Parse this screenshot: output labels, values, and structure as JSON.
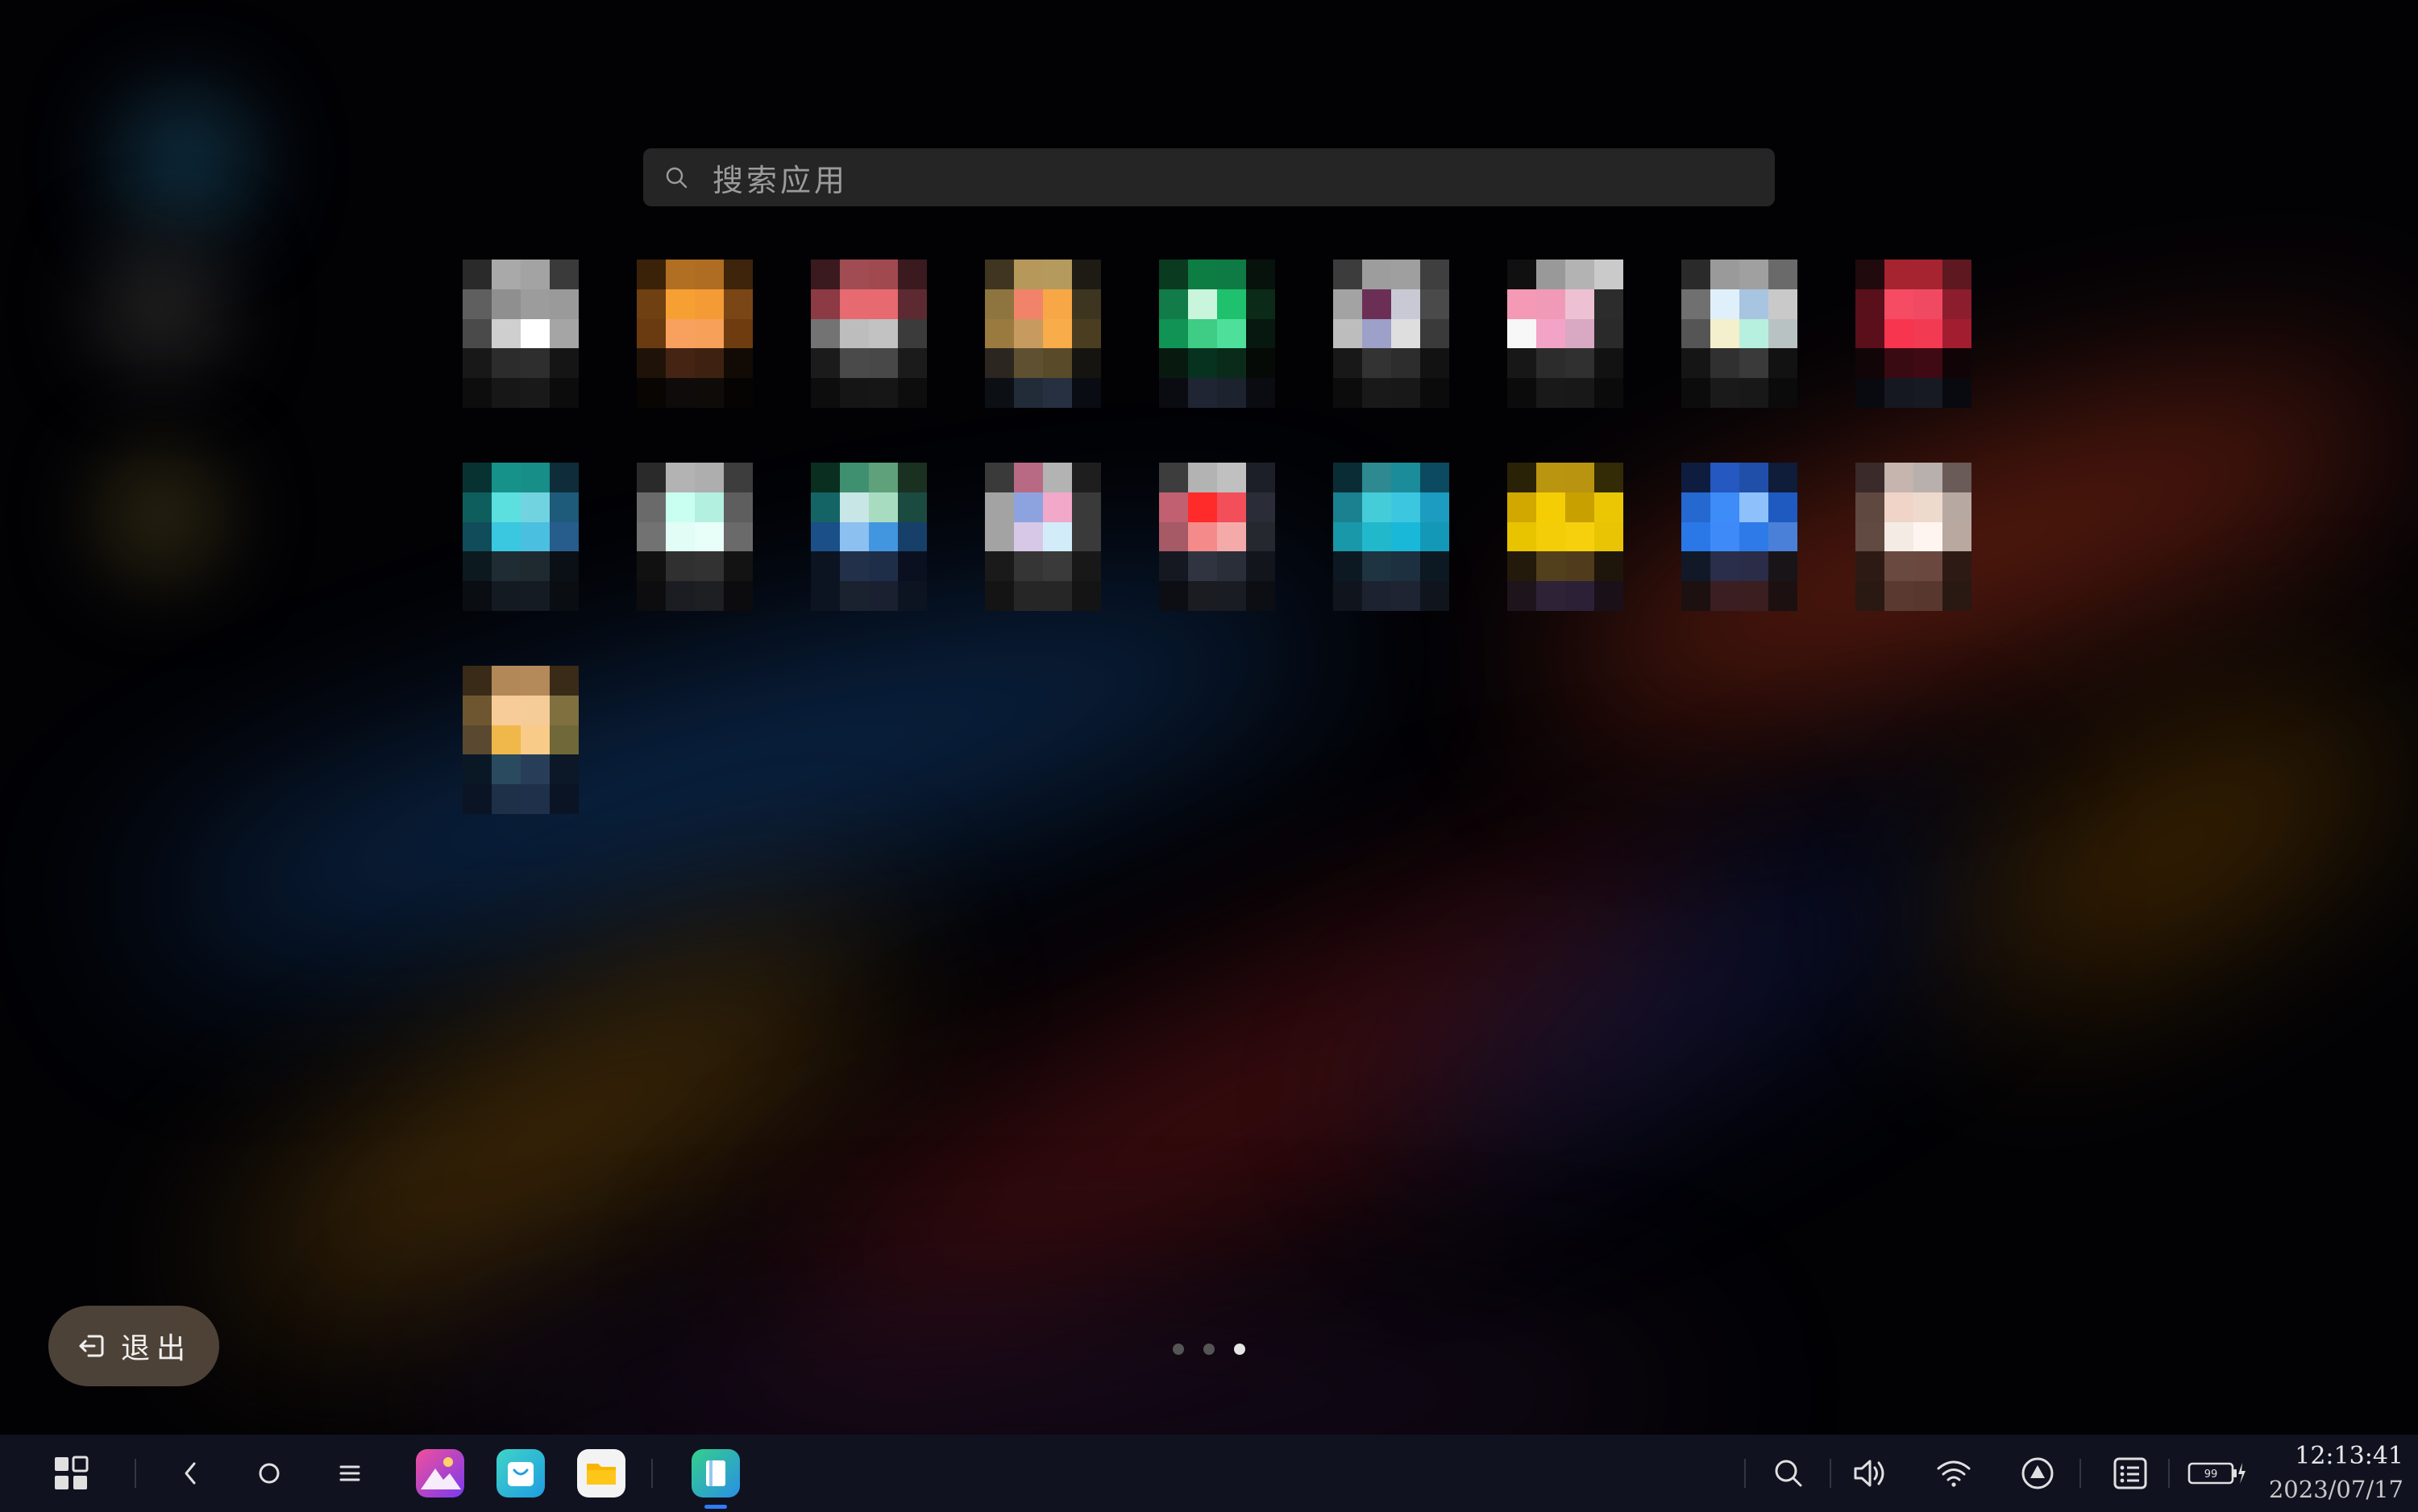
{
  "search": {
    "placeholder": "搜索应用"
  },
  "apps": [
    {
      "row": 0,
      "col": 0,
      "colors": [
        "#2a2a2a",
        "#a9a9a9",
        "#a3a3a3",
        "#3a3a3a",
        "#5f5f5f",
        "#8f8f8f",
        "#9c9c9c",
        "#9a9a9a",
        "#4a4a4a",
        "#cfcfcf",
        "#ffffff",
        "#a5a5a5",
        "#181818",
        "#2c2c2c",
        "#2e2e2e",
        "#151515",
        "#0d0d0d",
        "#171717",
        "#191919",
        "#0c0c0c"
      ]
    },
    {
      "row": 0,
      "col": 1,
      "colors": [
        "#3a2208",
        "#b06f22",
        "#ae6d22",
        "#3d240a",
        "#6e4012",
        "#f6a033",
        "#f49b35",
        "#7a4615",
        "#6a3a10",
        "#f8a05e",
        "#f7a05a",
        "#6e3c0f",
        "#1f1208",
        "#452414",
        "#3e2110",
        "#120a05",
        "#080503",
        "#0e0b0a",
        "#0f0b09",
        "#060403"
      ]
    },
    {
      "row": 0,
      "col": 2,
      "colors": [
        "#3a1a1f",
        "#a14c52",
        "#a04a50",
        "#3a1a1f",
        "#8c3a44",
        "#e76a71",
        "#e76a71",
        "#5c2a30",
        "#737373",
        "#bdbdbd",
        "#c2c2c2",
        "#3b3b3b",
        "#1b1b1b",
        "#4a4a4a",
        "#484848",
        "#1b1b1b",
        "#0d0d0d",
        "#151515",
        "#161616",
        "#0d0d0d"
      ]
    },
    {
      "row": 0,
      "col": 3,
      "colors": [
        "#3f3520",
        "#b5985a",
        "#b59a5e",
        "#1d1b13",
        "#8e7540",
        "#f0836a",
        "#f7a745",
        "#3d3520",
        "#9b7a40",
        "#c79a5f",
        "#f8ac4a",
        "#4b3e20",
        "#2b2620",
        "#5e5030",
        "#594a2a",
        "#151410",
        "#0c0f14",
        "#222b38",
        "#273040",
        "#090c12"
      ]
    },
    {
      "row": 0,
      "col": 4,
      "colors": [
        "#0a3a20",
        "#0e7d44",
        "#0f7b44",
        "#07120c",
        "#127c48",
        "#c9f5dc",
        "#1fc16e",
        "#0c2a18",
        "#109355",
        "#3fcc85",
        "#4ee09a",
        "#06180f",
        "#081a10",
        "#083220",
        "#0a2a1a",
        "#050a06",
        "#0a0c12",
        "#1f2532",
        "#1c222e",
        "#0a0c12"
      ]
    },
    {
      "row": 0,
      "col": 5,
      "colors": [
        "#3c3c3c",
        "#9d9d9d",
        "#9f9f9f",
        "#3f3f3f",
        "#a3a3a3",
        "#6b2f56",
        "#c9c9d6",
        "#4a4a4a",
        "#bdbdbd",
        "#9da0c8",
        "#dedede",
        "#3a3a3a",
        "#181818",
        "#333333",
        "#2d2d2d",
        "#121212",
        "#0c0c0c",
        "#191919",
        "#181818",
        "#0b0b0b"
      ]
    },
    {
      "row": 0,
      "col": 6,
      "colors": [
        "#101010",
        "#999999",
        "#b3b3b3",
        "#cacaca",
        "#f49ab6",
        "#f09ab8",
        "#eec1d2",
        "#2c2c2c",
        "#f7f7f7",
        "#f3a3c5",
        "#d9a8c2",
        "#2a2a2a",
        "#171717",
        "#2c2c2c",
        "#303030",
        "#121212",
        "#0b0b0b",
        "#191919",
        "#181818",
        "#0b0b0b"
      ]
    },
    {
      "row": 0,
      "col": 7,
      "colors": [
        "#2a2a2a",
        "#9a9a9a",
        "#a0a0a0",
        "#6a6a6a",
        "#707070",
        "#e0f0fa",
        "#a7c4e0",
        "#c9c9c9",
        "#555555",
        "#f4efcc",
        "#b7f0de",
        "#b8c2c2",
        "#151515",
        "#303030",
        "#3a3a3a",
        "#121212",
        "#0c0c0c",
        "#1a1a1a",
        "#181818",
        "#0b0b0b"
      ]
    },
    {
      "row": 0,
      "col": 8,
      "colors": [
        "#200a0e",
        "#a5242f",
        "#a62430",
        "#5d1820",
        "#5a101a",
        "#f54b63",
        "#f04a62",
        "#8c1d2c",
        "#5a0f1a",
        "#f8354f",
        "#f33a53",
        "#a31d30",
        "#110507",
        "#3a0a12",
        "#400a14",
        "#110407",
        "#090a10",
        "#151820",
        "#171a22",
        "#090a10"
      ]
    },
    {
      "row": 1,
      "col": 0,
      "colors": [
        "#083232",
        "#17928a",
        "#178e88",
        "#0e2c3a",
        "#0f5e5e",
        "#5be0df",
        "#72d3e0",
        "#1e5a7a",
        "#104c5a",
        "#3ac8e0",
        "#4bbfe0",
        "#275d8c",
        "#0c1a20",
        "#1f2c34",
        "#1f2a30",
        "#0a1015",
        "#0a0d12",
        "#141a22",
        "#151b22",
        "#0a0d12"
      ]
    },
    {
      "row": 1,
      "col": 1,
      "colors": [
        "#2a2a2a",
        "#b3b3b3",
        "#aeaeae",
        "#3d3d3d",
        "#6a6a6a",
        "#c9fff0",
        "#b4f0e0",
        "#5e5e5e",
        "#727272",
        "#e2fdf6",
        "#e8fff9",
        "#6a6a6a",
        "#111111",
        "#303030",
        "#323232",
        "#131313",
        "#0d0d0f",
        "#1c1d22",
        "#1e1f22",
        "#0c0c0e"
      ]
    },
    {
      "row": 1,
      "col": 2,
      "colors": [
        "#0a2e20",
        "#3f9070",
        "#5ea17a",
        "#1a3020",
        "#146465",
        "#c8e6e6",
        "#a8dcc0",
        "#1b4a40",
        "#1b4f88",
        "#8cc0f0",
        "#4296e0",
        "#16406a",
        "#0c1422",
        "#22304a",
        "#1f2e48",
        "#0a1020",
        "#0c1422",
        "#1a2230",
        "#1a2030",
        "#0c1422"
      ]
    },
    {
      "row": 1,
      "col": 3,
      "colors": [
        "#3a3a3a",
        "#b86a85",
        "#b3b3b3",
        "#1e1e1e",
        "#a3a3a3",
        "#8ca3e0",
        "#f2a8c8",
        "#3a3a3a",
        "#a3a3a3",
        "#d8c8e8",
        "#d2ecfa",
        "#3a3a3a",
        "#1a1a1a",
        "#353535",
        "#3a3a3a",
        "#181818",
        "#141414",
        "#262626",
        "#262626",
        "#141414"
      ]
    },
    {
      "row": 1,
      "col": 4,
      "colors": [
        "#3d3d3d",
        "#b3b3b3",
        "#c0c0c0",
        "#1c1e28",
        "#c06070",
        "#ff2a2a",
        "#f24f5a",
        "#2a2c38",
        "#a55a66",
        "#f58a8a",
        "#f5aaaa",
        "#262830",
        "#151820",
        "#303440",
        "#2a2e38",
        "#12151c",
        "#0c0e14",
        "#1a1c22",
        "#1a1c24",
        "#0c0e14"
      ]
    },
    {
      "row": 1,
      "col": 5,
      "colors": [
        "#0a2d35",
        "#2e8a90",
        "#1b8c9a",
        "#0b4a60",
        "#1b8090",
        "#44ccd8",
        "#3dc6e0",
        "#1c9cc0",
        "#1898a8",
        "#22b8cc",
        "#1ab8d8",
        "#1498b8",
        "#0c1822",
        "#1e3440",
        "#1c3040",
        "#0c1822",
        "#10141c",
        "#1c2230",
        "#1e2432",
        "#10141c"
      ]
    },
    {
      "row": 1,
      "col": 6,
      "colors": [
        "#2a2206",
        "#b99510",
        "#b89411",
        "#332a06",
        "#d0a800",
        "#f5cd04",
        "#c8a000",
        "#eac604",
        "#e8c400",
        "#f3cd07",
        "#f6d00c",
        "#e8c404",
        "#231a0c",
        "#52401c",
        "#503c1c",
        "#1e160a",
        "#1e141c",
        "#2e2236",
        "#2c2036",
        "#1a1018"
      ]
    },
    {
      "row": 1,
      "col": 7,
      "colors": [
        "#0e1c40",
        "#2558c0",
        "#1f4fa8",
        "#0f1c3a",
        "#2468d0",
        "#3d8cf8",
        "#8ec0fc",
        "#1f5ac0",
        "#2a78e8",
        "#3e8af8",
        "#2d7ae8",
        "#4a80d8",
        "#111828",
        "#2a2e4a",
        "#2a2c48",
        "#181418",
        "#1c1010",
        "#3a1e22",
        "#3a1e20",
        "#1c1010"
      ]
    },
    {
      "row": 1,
      "col": 8,
      "colors": [
        "#3a2a2a",
        "#c5b5ae",
        "#b8b0ad",
        "#6a5a58",
        "#5e4840",
        "#f0d4c8",
        "#eedacc",
        "#b8a8a2",
        "#604a42",
        "#f4ece4",
        "#fff5f0",
        "#b8a8a0",
        "#2e1a14",
        "#6a4a40",
        "#6a4840",
        "#2e1a14",
        "#2a1812",
        "#5a3a30",
        "#58382e",
        "#2a1812"
      ]
    },
    {
      "row": 2,
      "col": 0,
      "colors": [
        "#3a2a18",
        "#b38858",
        "#b48a5a",
        "#3a2a18",
        "#6e5630",
        "#f8cc98",
        "#f5cc98",
        "#807040",
        "#5a4830",
        "#f0b84a",
        "#f8cc88",
        "#706838",
        "#0a1826",
        "#2a4a60",
        "#283e58",
        "#0c1828",
        "#0a1424",
        "#1e3048",
        "#1e304a",
        "#0a1424"
      ]
    }
  ],
  "pager": {
    "pages": 3,
    "current": 2
  },
  "exit_button": {
    "label": "退出",
    "icon": "exit-icon"
  },
  "taskbar": {
    "nav": [
      {
        "name": "app-drawer",
        "icon": "grid-icon"
      },
      {
        "name": "back",
        "icon": "back-icon"
      },
      {
        "name": "home",
        "icon": "home-circle-icon"
      },
      {
        "name": "recents",
        "icon": "menu-icon"
      }
    ],
    "pinned_apps": [
      {
        "name": "gallery",
        "icon": "gallery-icon",
        "color": "#e04a8a"
      },
      {
        "name": "store",
        "icon": "store-icon",
        "color": "#2ec4cf"
      },
      {
        "name": "files",
        "icon": "files-icon",
        "color": "#f7b500"
      }
    ],
    "running_apps": [
      {
        "name": "notes",
        "icon": "book-icon",
        "color": "#2aa7e0",
        "active": true
      }
    ],
    "status": [
      {
        "name": "search",
        "icon": "search-icon"
      },
      {
        "name": "volume",
        "icon": "volume-icon"
      },
      {
        "name": "wifi",
        "icon": "wifi-icon"
      },
      {
        "name": "upload",
        "icon": "arrow-up-circle-icon"
      },
      {
        "name": "notifications",
        "icon": "list-icon"
      }
    ],
    "battery": {
      "level": "99",
      "icon": "battery-charging-icon"
    },
    "clock": {
      "time": "12:13:41",
      "date": "2023/07/17"
    }
  },
  "colors": {
    "accent": "#2f7cf6",
    "taskbar": "#101220",
    "search_bg": "#252525"
  }
}
